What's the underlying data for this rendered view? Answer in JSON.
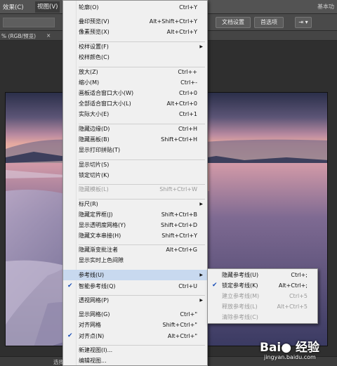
{
  "menubar": {
    "effect": "效果(C)",
    "view": "视图(V)",
    "workspace": "基本功"
  },
  "optionsbar": {
    "doc_settings": "文档设置",
    "preferences": "首选项",
    "dd_icon_label": "⇥ ▾"
  },
  "doctab": {
    "title": "% (RGB/预览)",
    "close": "×"
  },
  "status": {
    "text": "选择"
  },
  "view_menu": {
    "items": [
      {
        "label": "轮廓(O)",
        "shortcut": "Ctrl+Y"
      },
      {
        "label": "叠印预览(V)",
        "shortcut": "Alt+Shift+Ctrl+Y"
      },
      {
        "label": "像素预览(X)",
        "shortcut": "Alt+Ctrl+Y"
      },
      {
        "label": "校样设置(F)",
        "shortcut": ""
      },
      {
        "label": "校样颜色(C)",
        "shortcut": ""
      },
      {
        "label": "放大(Z)",
        "shortcut": "Ctrl++"
      },
      {
        "label": "缩小(M)",
        "shortcut": "Ctrl+-"
      },
      {
        "label": "画板适合窗口大小(W)",
        "shortcut": "Ctrl+0"
      },
      {
        "label": "全部适合窗口大小(L)",
        "shortcut": "Alt+Ctrl+0"
      },
      {
        "label": "实际大小(E)",
        "shortcut": "Ctrl+1"
      },
      {
        "label": "隐藏边缘(D)",
        "shortcut": "Ctrl+H"
      },
      {
        "label": "隐藏画板(B)",
        "shortcut": "Shift+Ctrl+H"
      },
      {
        "label": "显示打印拼贴(T)",
        "shortcut": ""
      },
      {
        "label": "显示切片(S)",
        "shortcut": ""
      },
      {
        "label": "锁定切片(K)",
        "shortcut": ""
      },
      {
        "label": "隐藏模板(L)",
        "shortcut": "Shift+Ctrl+W"
      },
      {
        "label": "标尺(R)",
        "shortcut": ""
      },
      {
        "label": "隐藏定界框(J)",
        "shortcut": "Shift+Ctrl+B"
      },
      {
        "label": "显示透明度网格(Y)",
        "shortcut": "Shift+Ctrl+D"
      },
      {
        "label": "隐藏文本串接(H)",
        "shortcut": "Shift+Ctrl+Y"
      },
      {
        "label": "隐藏渐变批注者",
        "shortcut": "Alt+Ctrl+G"
      },
      {
        "label": "显示实时上色间隙",
        "shortcut": ""
      },
      {
        "label": "参考线(U)",
        "shortcut": ""
      },
      {
        "label": "智能参考线(Q)",
        "shortcut": "Ctrl+U"
      },
      {
        "label": "透视网格(P)",
        "shortcut": ""
      },
      {
        "label": "显示网格(G)",
        "shortcut": "Ctrl+\""
      },
      {
        "label": "对齐网格",
        "shortcut": "Shift+Ctrl+\""
      },
      {
        "label": "对齐点(N)",
        "shortcut": "Alt+Ctrl+\""
      },
      {
        "label": "新建视图(I)...",
        "shortcut": ""
      },
      {
        "label": "编辑视图...",
        "shortcut": ""
      }
    ],
    "check_mark": "✔",
    "submenu_arrow": "▶"
  },
  "guides_submenu": {
    "items": [
      {
        "label": "隐藏参考线(U)",
        "shortcut": "Ctrl+;"
      },
      {
        "label": "锁定参考线(K)",
        "shortcut": "Alt+Ctrl+;"
      },
      {
        "label": "建立参考线(M)",
        "shortcut": "Ctrl+5"
      },
      {
        "label": "释放参考线(L)",
        "shortcut": "Alt+Ctrl+5"
      },
      {
        "label": "清除参考线(C)",
        "shortcut": ""
      }
    ]
  },
  "watermark": {
    "brand": "Bai● 经验",
    "url": "jingyan.baidu.com"
  }
}
